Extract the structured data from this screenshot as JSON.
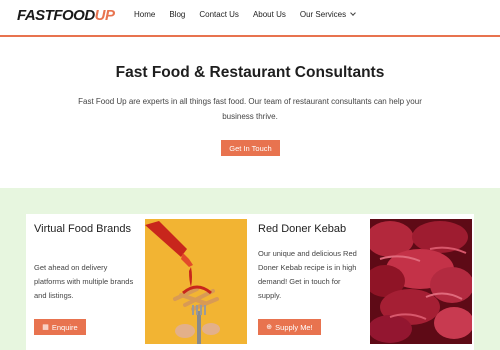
{
  "logo": {
    "part1": "FASTFOOD",
    "part2": "UP"
  },
  "nav": {
    "items": [
      {
        "label": "Home"
      },
      {
        "label": "Blog"
      },
      {
        "label": "Contact Us"
      },
      {
        "label": "About Us"
      },
      {
        "label": "Our Services"
      }
    ]
  },
  "hero": {
    "title": "Fast Food & Restaurant Consultants",
    "text": "Fast Food Up are experts in all things fast food. Our team of restaurant consultants can help your business thrive.",
    "button": "Get In Touch"
  },
  "cards": [
    {
      "title": "Virtual Food Brands",
      "text": "Get ahead on delivery platforms with multiple brands and listings.",
      "button": "Enquire",
      "button_icon": "building-icon"
    },
    {
      "title": "Red Doner Kebab",
      "text": "Our unique and delicious Red Doner Kebab recipe is in high demand! Get in touch for supply.",
      "button": "Supply Me!",
      "button_icon": "plus-circle-icon"
    }
  ],
  "colors": {
    "accent": "#e8734f",
    "section_bg": "#e7f6df",
    "image_yellow": "#f2b433",
    "image_meat": "#7a0f1e"
  }
}
